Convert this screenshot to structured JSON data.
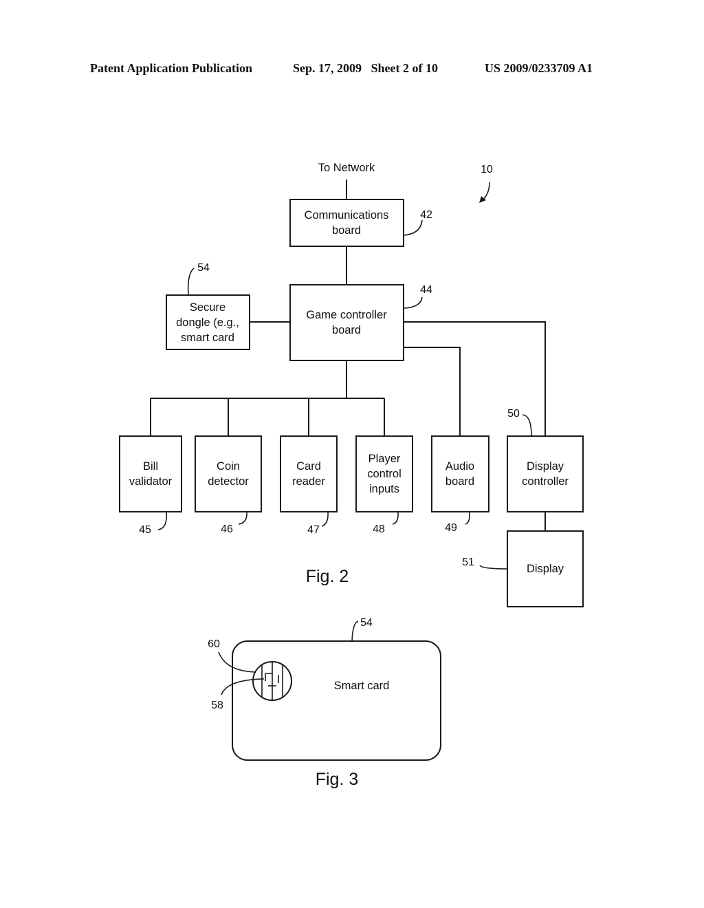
{
  "header": {
    "publication": "Patent Application Publication",
    "date_sheet": "Sep. 17, 2009   Sheet 2 of 10",
    "number": "US 2009/0233709 A1"
  },
  "fig2": {
    "caption": "Fig. 2",
    "system_ref": "10",
    "network_label": "To Network",
    "blocks": {
      "comm": {
        "lines": [
          "Communications",
          "board"
        ],
        "ref": "42"
      },
      "game": {
        "lines": [
          "Game controller",
          "board"
        ],
        "ref": "44"
      },
      "dongle": {
        "lines": [
          "Secure",
          "dongle (e.g.,",
          "smart card"
        ],
        "ref": "54"
      },
      "bill": {
        "lines": [
          "Bill",
          "validator"
        ],
        "ref": "45"
      },
      "coin": {
        "lines": [
          "Coin",
          "detector"
        ],
        "ref": "46"
      },
      "card": {
        "lines": [
          "Card",
          "reader"
        ],
        "ref": "47"
      },
      "player": {
        "lines": [
          "Player",
          "control",
          "inputs"
        ],
        "ref": "48"
      },
      "audio": {
        "lines": [
          "Audio",
          "board"
        ],
        "ref": "49"
      },
      "dispctl": {
        "lines": [
          "Display",
          "controller"
        ],
        "ref": "50"
      },
      "display": {
        "lines": [
          "Display"
        ],
        "ref": "51"
      }
    }
  },
  "fig3": {
    "caption": "Fig. 3",
    "card_label": "Smart card",
    "card_ref": "54",
    "chip_ref": "60",
    "contact_ref": "58"
  }
}
